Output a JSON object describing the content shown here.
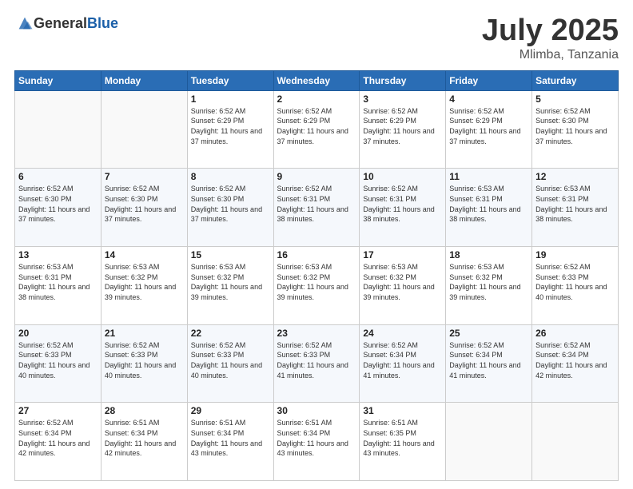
{
  "header": {
    "logo_general": "General",
    "logo_blue": "Blue",
    "month": "July 2025",
    "location": "Mlimba, Tanzania"
  },
  "days_of_week": [
    "Sunday",
    "Monday",
    "Tuesday",
    "Wednesday",
    "Thursday",
    "Friday",
    "Saturday"
  ],
  "weeks": [
    [
      {
        "day": "",
        "sunrise": "",
        "sunset": "",
        "daylight": ""
      },
      {
        "day": "",
        "sunrise": "",
        "sunset": "",
        "daylight": ""
      },
      {
        "day": "1",
        "sunrise": "Sunrise: 6:52 AM",
        "sunset": "Sunset: 6:29 PM",
        "daylight": "Daylight: 11 hours and 37 minutes."
      },
      {
        "day": "2",
        "sunrise": "Sunrise: 6:52 AM",
        "sunset": "Sunset: 6:29 PM",
        "daylight": "Daylight: 11 hours and 37 minutes."
      },
      {
        "day": "3",
        "sunrise": "Sunrise: 6:52 AM",
        "sunset": "Sunset: 6:29 PM",
        "daylight": "Daylight: 11 hours and 37 minutes."
      },
      {
        "day": "4",
        "sunrise": "Sunrise: 6:52 AM",
        "sunset": "Sunset: 6:29 PM",
        "daylight": "Daylight: 11 hours and 37 minutes."
      },
      {
        "day": "5",
        "sunrise": "Sunrise: 6:52 AM",
        "sunset": "Sunset: 6:30 PM",
        "daylight": "Daylight: 11 hours and 37 minutes."
      }
    ],
    [
      {
        "day": "6",
        "sunrise": "Sunrise: 6:52 AM",
        "sunset": "Sunset: 6:30 PM",
        "daylight": "Daylight: 11 hours and 37 minutes."
      },
      {
        "day": "7",
        "sunrise": "Sunrise: 6:52 AM",
        "sunset": "Sunset: 6:30 PM",
        "daylight": "Daylight: 11 hours and 37 minutes."
      },
      {
        "day": "8",
        "sunrise": "Sunrise: 6:52 AM",
        "sunset": "Sunset: 6:30 PM",
        "daylight": "Daylight: 11 hours and 37 minutes."
      },
      {
        "day": "9",
        "sunrise": "Sunrise: 6:52 AM",
        "sunset": "Sunset: 6:31 PM",
        "daylight": "Daylight: 11 hours and 38 minutes."
      },
      {
        "day": "10",
        "sunrise": "Sunrise: 6:52 AM",
        "sunset": "Sunset: 6:31 PM",
        "daylight": "Daylight: 11 hours and 38 minutes."
      },
      {
        "day": "11",
        "sunrise": "Sunrise: 6:53 AM",
        "sunset": "Sunset: 6:31 PM",
        "daylight": "Daylight: 11 hours and 38 minutes."
      },
      {
        "day": "12",
        "sunrise": "Sunrise: 6:53 AM",
        "sunset": "Sunset: 6:31 PM",
        "daylight": "Daylight: 11 hours and 38 minutes."
      }
    ],
    [
      {
        "day": "13",
        "sunrise": "Sunrise: 6:53 AM",
        "sunset": "Sunset: 6:31 PM",
        "daylight": "Daylight: 11 hours and 38 minutes."
      },
      {
        "day": "14",
        "sunrise": "Sunrise: 6:53 AM",
        "sunset": "Sunset: 6:32 PM",
        "daylight": "Daylight: 11 hours and 39 minutes."
      },
      {
        "day": "15",
        "sunrise": "Sunrise: 6:53 AM",
        "sunset": "Sunset: 6:32 PM",
        "daylight": "Daylight: 11 hours and 39 minutes."
      },
      {
        "day": "16",
        "sunrise": "Sunrise: 6:53 AM",
        "sunset": "Sunset: 6:32 PM",
        "daylight": "Daylight: 11 hours and 39 minutes."
      },
      {
        "day": "17",
        "sunrise": "Sunrise: 6:53 AM",
        "sunset": "Sunset: 6:32 PM",
        "daylight": "Daylight: 11 hours and 39 minutes."
      },
      {
        "day": "18",
        "sunrise": "Sunrise: 6:53 AM",
        "sunset": "Sunset: 6:32 PM",
        "daylight": "Daylight: 11 hours and 39 minutes."
      },
      {
        "day": "19",
        "sunrise": "Sunrise: 6:52 AM",
        "sunset": "Sunset: 6:33 PM",
        "daylight": "Daylight: 11 hours and 40 minutes."
      }
    ],
    [
      {
        "day": "20",
        "sunrise": "Sunrise: 6:52 AM",
        "sunset": "Sunset: 6:33 PM",
        "daylight": "Daylight: 11 hours and 40 minutes."
      },
      {
        "day": "21",
        "sunrise": "Sunrise: 6:52 AM",
        "sunset": "Sunset: 6:33 PM",
        "daylight": "Daylight: 11 hours and 40 minutes."
      },
      {
        "day": "22",
        "sunrise": "Sunrise: 6:52 AM",
        "sunset": "Sunset: 6:33 PM",
        "daylight": "Daylight: 11 hours and 40 minutes."
      },
      {
        "day": "23",
        "sunrise": "Sunrise: 6:52 AM",
        "sunset": "Sunset: 6:33 PM",
        "daylight": "Daylight: 11 hours and 41 minutes."
      },
      {
        "day": "24",
        "sunrise": "Sunrise: 6:52 AM",
        "sunset": "Sunset: 6:34 PM",
        "daylight": "Daylight: 11 hours and 41 minutes."
      },
      {
        "day": "25",
        "sunrise": "Sunrise: 6:52 AM",
        "sunset": "Sunset: 6:34 PM",
        "daylight": "Daylight: 11 hours and 41 minutes."
      },
      {
        "day": "26",
        "sunrise": "Sunrise: 6:52 AM",
        "sunset": "Sunset: 6:34 PM",
        "daylight": "Daylight: 11 hours and 42 minutes."
      }
    ],
    [
      {
        "day": "27",
        "sunrise": "Sunrise: 6:52 AM",
        "sunset": "Sunset: 6:34 PM",
        "daylight": "Daylight: 11 hours and 42 minutes."
      },
      {
        "day": "28",
        "sunrise": "Sunrise: 6:51 AM",
        "sunset": "Sunset: 6:34 PM",
        "daylight": "Daylight: 11 hours and 42 minutes."
      },
      {
        "day": "29",
        "sunrise": "Sunrise: 6:51 AM",
        "sunset": "Sunset: 6:34 PM",
        "daylight": "Daylight: 11 hours and 43 minutes."
      },
      {
        "day": "30",
        "sunrise": "Sunrise: 6:51 AM",
        "sunset": "Sunset: 6:34 PM",
        "daylight": "Daylight: 11 hours and 43 minutes."
      },
      {
        "day": "31",
        "sunrise": "Sunrise: 6:51 AM",
        "sunset": "Sunset: 6:35 PM",
        "daylight": "Daylight: 11 hours and 43 minutes."
      },
      {
        "day": "",
        "sunrise": "",
        "sunset": "",
        "daylight": ""
      },
      {
        "day": "",
        "sunrise": "",
        "sunset": "",
        "daylight": ""
      }
    ]
  ]
}
